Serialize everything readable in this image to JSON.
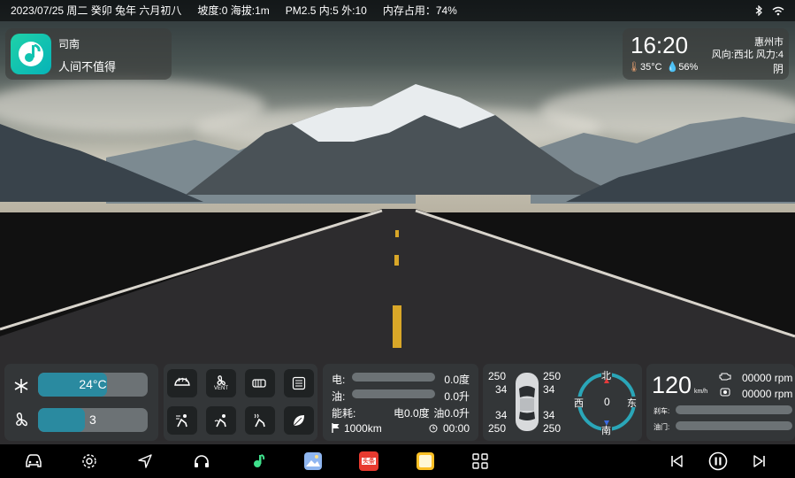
{
  "status_bar": {
    "date": "2023/07/25 周二 癸卯 兔年 六月初八",
    "slope_altitude": "坡度:0 海拔:1m",
    "air": "PM2.5 内:5 外:10",
    "memory": "内存占用：74%",
    "icons": [
      "bluetooth-icon",
      "wifi-icon"
    ]
  },
  "music": {
    "artist": "司南",
    "title": "人间不值得"
  },
  "weather": {
    "time": "16:20",
    "city": "惠州市",
    "wind": "风向:西北  风力:4",
    "temperature": "35°C",
    "humidity": "56%",
    "condition": "阴"
  },
  "climate": {
    "temperature": "24°C",
    "temperature_level": 0.63,
    "fan": "3",
    "fan_level": 0.43
  },
  "controls": {
    "vent_label": "VENT",
    "buttons": [
      "car-defrost-icon",
      "fan-vent-icon",
      "seat-heat-icon",
      "settings-list-icon",
      "seat-wind-icon",
      "seat-airflow-icon",
      "seat-heating-icon",
      "eco-leaf-icon"
    ]
  },
  "energy": {
    "electric_label": "电:",
    "electric_value": "0.0度",
    "fuel_label": "油:",
    "fuel_value": "0.0升",
    "consumption_label": "能耗:",
    "consumption_electric": "电0.0度",
    "consumption_fuel": "油0.0升",
    "distance": "1000km",
    "duration": "00:00"
  },
  "car": {
    "tire_fl_pressure": "250",
    "tire_fl_temp": "34",
    "tire_fr_pressure": "250",
    "tire_fr_temp": "34",
    "tire_rl_temp": "34",
    "tire_rl_pressure": "250",
    "tire_rr_temp": "34",
    "tire_rr_pressure": "250",
    "compass_n": "北",
    "compass_s": "南",
    "compass_w": "西",
    "compass_e": "东",
    "heading": "0"
  },
  "speed": {
    "value": "120",
    "unit": "km/h",
    "rpm1": "00000 rpm",
    "rpm2": "00000 rpm",
    "brake_label": "刹车:",
    "throttle_label": "油门:"
  },
  "dock": {
    "left": [
      "car-icon",
      "settings-icon",
      "navigation-icon",
      "headphones-icon",
      "music-app-icon",
      "photos-app-icon",
      "news-app-icon",
      "notes-app-icon",
      "apps-grid-icon"
    ],
    "news_label": "头条",
    "right": [
      "previous-track-icon",
      "pause-icon",
      "next-track-icon"
    ]
  }
}
